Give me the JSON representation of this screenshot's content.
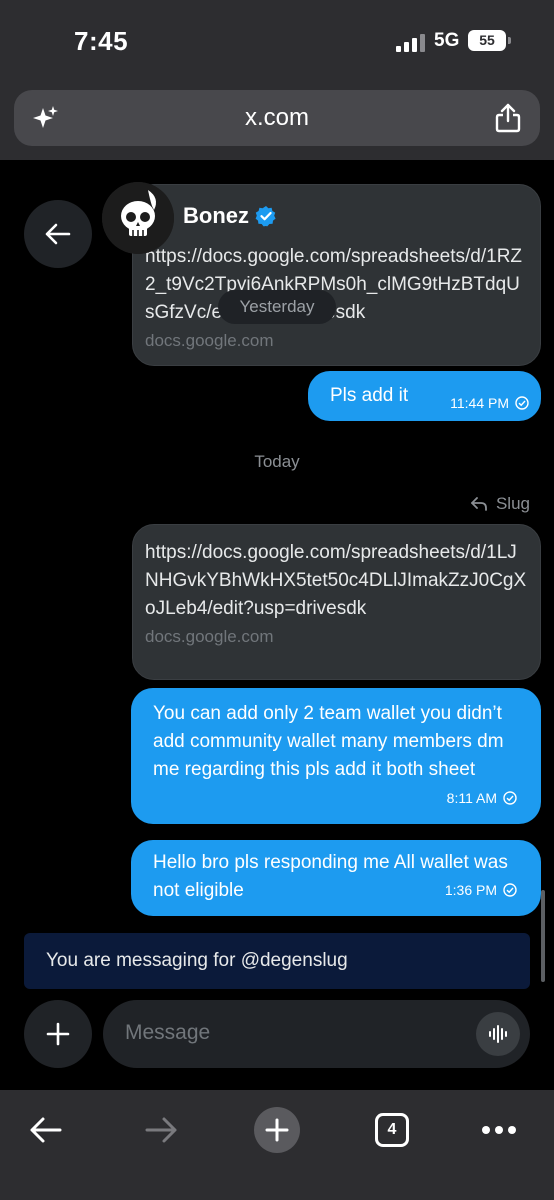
{
  "status_bar": {
    "time": "7:45",
    "network": "5G",
    "battery": "55"
  },
  "browser": {
    "url": "x.com",
    "tab_count": "4"
  },
  "header": {
    "contact_name": "Bonez",
    "date_pill": "Yesterday"
  },
  "messages": {
    "link1": {
      "text": "https://docs.google.com/spreadsheets/d/1RZ2_t9Vc2Tpyi6AnkRPMs0h_clMG9tHzBTdqUsGfzVc/edit?usp=drivesdk",
      "domain": "docs.google.com"
    },
    "out1": {
      "text": "Pls add it",
      "time": "11:44 PM"
    },
    "today_label": "Today",
    "reply_label": "Slug",
    "link2": {
      "text": "https://docs.google.com/spreadsheets/d/1LJNHGvkYBhWkHX5tet50c4DLlJImakZzJ0CgXoJLeb4/edit?usp=drivesdk",
      "domain": "docs.google.com"
    },
    "out2": {
      "text": "You can add only 2 team wallet you didn’t add community wallet many members dm me regarding this pls add it both sheet",
      "time": "8:11 AM"
    },
    "out3": {
      "text": "Hello bro pls responding me All wallet was not eligible",
      "time": "1:36 PM"
    }
  },
  "banner": {
    "text": "You are messaging for @degenslug"
  },
  "composer": {
    "placeholder": "Message"
  },
  "colors": {
    "accent": "#1d9bf0",
    "banner_bg": "#0b1a3a",
    "incoming_bg": "#2f3336"
  },
  "icons": [
    "sparkle-icon",
    "share-icon",
    "back-arrow-icon",
    "verified-icon",
    "reply-icon",
    "read-check-icon",
    "plus-icon",
    "voice-wave-icon",
    "forward-arrow-icon",
    "more-icon"
  ]
}
